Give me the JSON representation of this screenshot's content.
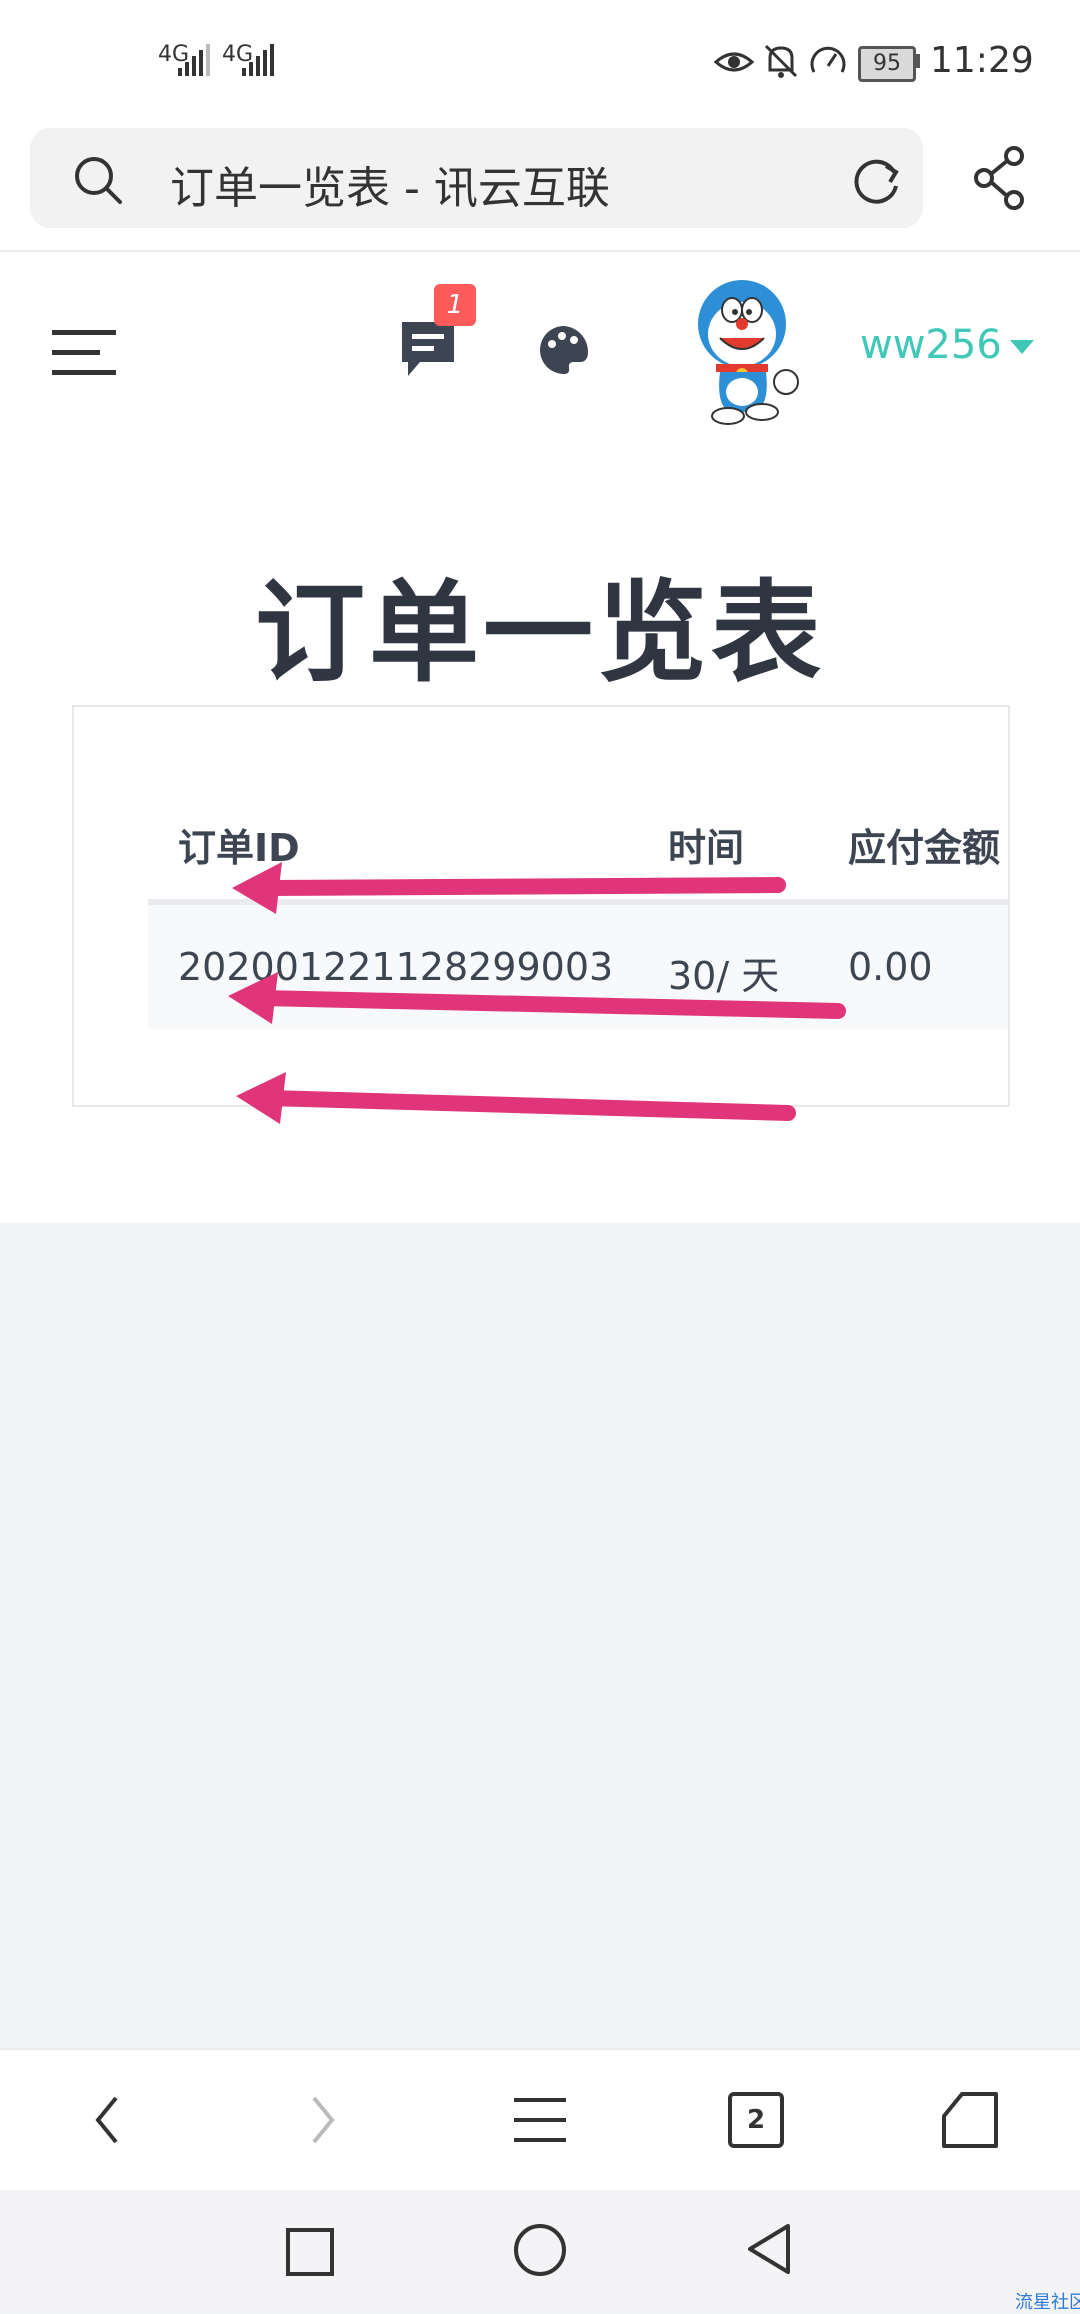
{
  "status_bar": {
    "signal_1": "4G",
    "signal_2": "4G",
    "battery": "95",
    "time": "11:29",
    "icons": [
      "eye-icon",
      "bell-off-icon",
      "speedometer-icon",
      "battery-icon"
    ]
  },
  "browser": {
    "url_title": "订单一览表 - 讯云互联",
    "icons": [
      "search-icon",
      "refresh-icon",
      "share-icon"
    ]
  },
  "site_header": {
    "notification_count": "1",
    "username": "ww256",
    "icons": [
      "menu-icon",
      "message-icon",
      "palette-icon",
      "avatar",
      "caret-down-icon"
    ]
  },
  "page": {
    "title": "订单一览表"
  },
  "table": {
    "columns": [
      "订单ID",
      "时间",
      "应付金额"
    ],
    "rows": [
      [
        "202001221128299003",
        "30/ 天",
        "0.00"
      ]
    ]
  },
  "bottom_nav": {
    "tab_count": "2",
    "icons": [
      "back-icon",
      "forward-icon",
      "menu-lines-icon",
      "tabs-icon",
      "home-icon"
    ]
  },
  "system_nav": {
    "icons": [
      "recent-apps-icon",
      "home-circle-icon",
      "back-triangle-icon"
    ]
  },
  "watermark": "流星社区",
  "colors": {
    "accent": "#3fc8b7",
    "badge": "#ff5b5b",
    "arrow": "#e0357a",
    "text": "#2f3642"
  }
}
